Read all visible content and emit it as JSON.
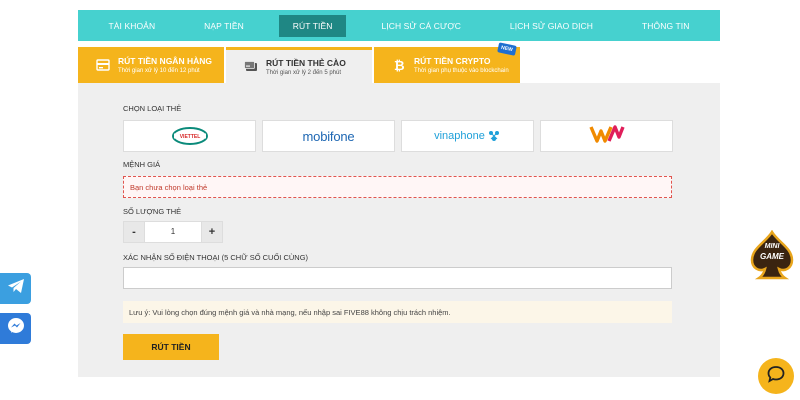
{
  "nav": {
    "items": [
      {
        "label": "TÀI KHOẢN"
      },
      {
        "label": "NẠP TIỀN"
      },
      {
        "label": "RÚT TIỀN"
      },
      {
        "label": "LỊCH SỬ CÁ CƯỢC"
      },
      {
        "label": "LỊCH SỬ GIAO DỊCH"
      },
      {
        "label": "THÔNG TIN"
      }
    ],
    "active_index": 2
  },
  "tabs": [
    {
      "title": "RÚT TIỀN NGÂN HÀNG",
      "subtitle": "Thời gian xử lý 10 đến 12 phút",
      "icon": "bank-card-icon"
    },
    {
      "title": "RÚT TIỀN THẺ CÀO",
      "subtitle": "Thời gian xử lý 2 đến 5 phút",
      "icon": "scratch-card-icon"
    },
    {
      "title": "RÚT TIỀN CRYPTO",
      "subtitle": "Thời gian phụ thuộc vào blockchain",
      "icon": "bitcoin-icon",
      "badge": "NEW"
    }
  ],
  "active_tab": 1,
  "form": {
    "card_type_label": "CHỌN LOẠI THẺ",
    "carriers": [
      {
        "name": "viettel",
        "text": "VIETTEL"
      },
      {
        "name": "mobifone",
        "text": "mobifone"
      },
      {
        "name": "vinaphone",
        "text": "vinaphone"
      },
      {
        "name": "vietnamobile",
        "text": ""
      }
    ],
    "denomination_label": "MỆNH GIÁ",
    "denomination_error": "Bạn chưa chọn loại thẻ",
    "quantity_label": "SỐ LƯỢNG THẺ",
    "quantity_minus": "-",
    "quantity_value": "1",
    "quantity_plus": "+",
    "phone_label": "XÁC NHẬN SỐ ĐIỆN THOẠI (5 CHỮ SỐ CUỐI CÙNG)",
    "phone_value": "",
    "phone_placeholder": "",
    "note": "Lưu ý: Vui lòng chọn đúng mệnh giá và nhà mạng, nếu nhập sai FIVE88 không chịu trách nhiệm.",
    "submit_label": "RÚT TIỀN"
  },
  "widgets": {
    "minigame_line1": "MINI",
    "minigame_line2": "GAME"
  },
  "colors": {
    "nav_bg": "#46d1cf",
    "nav_active": "#1f8784",
    "accent": "#f5b41c",
    "error": "#e0554f"
  }
}
